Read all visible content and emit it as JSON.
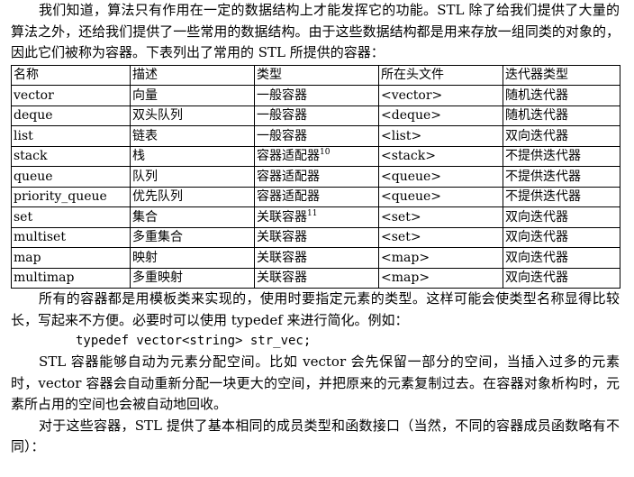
{
  "intro": {
    "text": "我们知道，算法只有作用在一定的数据结构上才能发挥它的功能。STL 除了给我们提供了大量的算法之外，还给我们提供了一些常用的数据结构。由于这些数据结构都是用来存放一组同类的对象的，因此它们被称为容器。下表列出了常用的 STL 所提供的容器："
  },
  "table": {
    "headers": [
      "名称",
      "描述",
      "类型",
      "所在头文件",
      "迭代器类型"
    ],
    "rows": [
      {
        "name": "vector",
        "desc": "向量",
        "type": "一般容器",
        "type_note": "",
        "header": "<vector>",
        "iter": "随机迭代器"
      },
      {
        "name": "deque",
        "desc": "双头队列",
        "type": "一般容器",
        "type_note": "",
        "header": "<deque>",
        "iter": "随机迭代器"
      },
      {
        "name": "list",
        "desc": "链表",
        "type": "一般容器",
        "type_note": "",
        "header": "<list>",
        "iter": "双向迭代器"
      },
      {
        "name": "stack",
        "desc": "栈",
        "type": "容器适配器",
        "type_note": "10",
        "header": "<stack>",
        "iter": "不提供迭代器"
      },
      {
        "name": "queue",
        "desc": "队列",
        "type": "容器适配器",
        "type_note": "",
        "header": "<queue>",
        "iter": "不提供迭代器"
      },
      {
        "name": "priority_queue",
        "desc": "优先队列",
        "type": "容器适配器",
        "type_note": "",
        "header": "<queue>",
        "iter": "不提供迭代器"
      },
      {
        "name": "set",
        "desc": "集合",
        "type": "关联容器",
        "type_note": "11",
        "header": "<set>",
        "iter": "双向迭代器"
      },
      {
        "name": "multiset",
        "desc": "多重集合",
        "type": "关联容器",
        "type_note": "",
        "header": "<set>",
        "iter": "双向迭代器"
      },
      {
        "name": "map",
        "desc": "映射",
        "type": "关联容器",
        "type_note": "",
        "header": "<map>",
        "iter": "双向迭代器"
      },
      {
        "name": "multimap",
        "desc": "多重映射",
        "type": "关联容器",
        "type_note": "",
        "header": "<map>",
        "iter": "双向迭代器"
      }
    ]
  },
  "para2": {
    "text": "所有的容器都是用模板类来实现的，使用时要指定元素的类型。这样可能会使类型名称显得比较长，写起来不方便。必要时可以使用 typedef 来进行简化。例如："
  },
  "code": {
    "line": "typedef vector<string> str_vec;"
  },
  "para3": {
    "text": "STL 容器能够自动为元素分配空间。比如 vector 会先保留一部分的空间，当插入过多的元素时，vector 容器会自动重新分配一块更大的空间，并把原来的元素复制过去。在容器对象析构时，元素所占用的空间也会被自动地回收。"
  },
  "para4": {
    "text": "对于这些容器，STL 提供了基本相同的成员类型和函数接口（当然，不同的容器成员函数略有不同）："
  }
}
